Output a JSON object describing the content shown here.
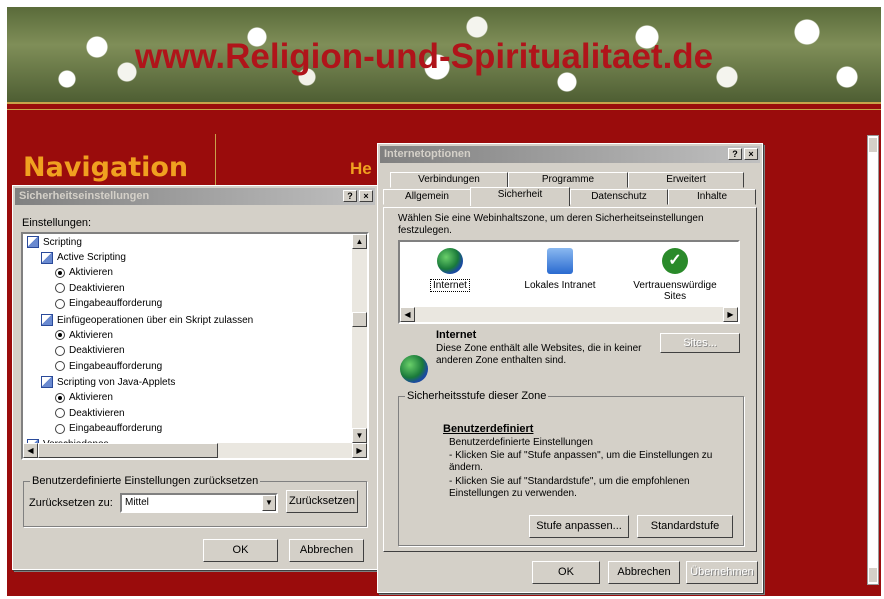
{
  "site": {
    "banner_title": "www.Religion-und-Spiritualitaet.de",
    "nav_title": "Navigation",
    "nav_partial": "He"
  },
  "security_dialog": {
    "title": "Sicherheitseinstellungen",
    "help_btn": "?",
    "close_btn": "×",
    "settings_label": "Einstellungen:",
    "tree": [
      {
        "kind": "header",
        "label": "Scripting",
        "level": 0
      },
      {
        "kind": "header",
        "label": "Active Scripting",
        "level": 1
      },
      {
        "kind": "radio",
        "label": "Aktivieren",
        "checked": true
      },
      {
        "kind": "radio",
        "label": "Deaktivieren",
        "checked": false
      },
      {
        "kind": "radio",
        "label": "Eingabeaufforderung",
        "checked": false
      },
      {
        "kind": "header",
        "label": "Einfügeoperationen über ein Skript zulassen",
        "level": 1
      },
      {
        "kind": "radio",
        "label": "Aktivieren",
        "checked": true
      },
      {
        "kind": "radio",
        "label": "Deaktivieren",
        "checked": false
      },
      {
        "kind": "radio",
        "label": "Eingabeaufforderung",
        "checked": false
      },
      {
        "kind": "header",
        "label": "Scripting von Java-Applets",
        "level": 1
      },
      {
        "kind": "radio",
        "label": "Aktivieren",
        "checked": true
      },
      {
        "kind": "radio",
        "label": "Deaktivieren",
        "checked": false
      },
      {
        "kind": "radio",
        "label": "Eingabeaufforderung",
        "checked": false
      },
      {
        "kind": "header",
        "label": "Verschiedenes",
        "level": 0
      }
    ],
    "reset_group_label": "Benutzerdefinierte Einstellungen zurücksetzen",
    "reset_to_label": "Zurücksetzen zu:",
    "reset_to_value": "Mittel",
    "reset_button": "Zurücksetzen",
    "ok_button": "OK",
    "cancel_button": "Abbrechen"
  },
  "internet_options": {
    "title": "Internetoptionen",
    "help_btn": "?",
    "close_btn": "×",
    "tabs_row1": [
      "Verbindungen",
      "Programme",
      "Erweitert"
    ],
    "tabs_row2": [
      "Allgemein",
      "Sicherheit",
      "Datenschutz",
      "Inhalte"
    ],
    "selected_tab": "Sicherheit",
    "intro": "Wählen Sie eine Webinhaltszone, um deren Sicherheitseinstellungen festzulegen.",
    "zones": [
      {
        "label": "Internet",
        "icon": "globe-icon",
        "color": "#1a7a3a"
      },
      {
        "label": "Lokales Intranet",
        "icon": "monitor-globe-icon",
        "color": "#2a6ad0"
      },
      {
        "label": "Vertrauenswürdige Sites",
        "icon": "check-icon",
        "color": "#2a8a2a"
      }
    ],
    "zone_name": "Internet",
    "zone_desc": "Diese Zone enthält alle Websites, die in keiner anderen Zone enthalten sind.",
    "sites_button": "Sites...",
    "level_group_label": "Sicherheitsstufe dieser Zone",
    "level_name": "Benutzerdefiniert",
    "level_line1": "Benutzerdefinierte Einstellungen",
    "level_line2": "- Klicken Sie auf \"Stufe anpassen\", um die Einstellungen zu ändern.",
    "level_line3": "- Klicken Sie auf \"Standardstufe\", um die empfohlenen Einstellungen zu verwenden.",
    "custom_level_button": "Stufe anpassen...",
    "default_level_button": "Standardstufe",
    "ok_button": "OK",
    "cancel_button": "Abbrechen",
    "apply_button": "Übernehmen"
  }
}
